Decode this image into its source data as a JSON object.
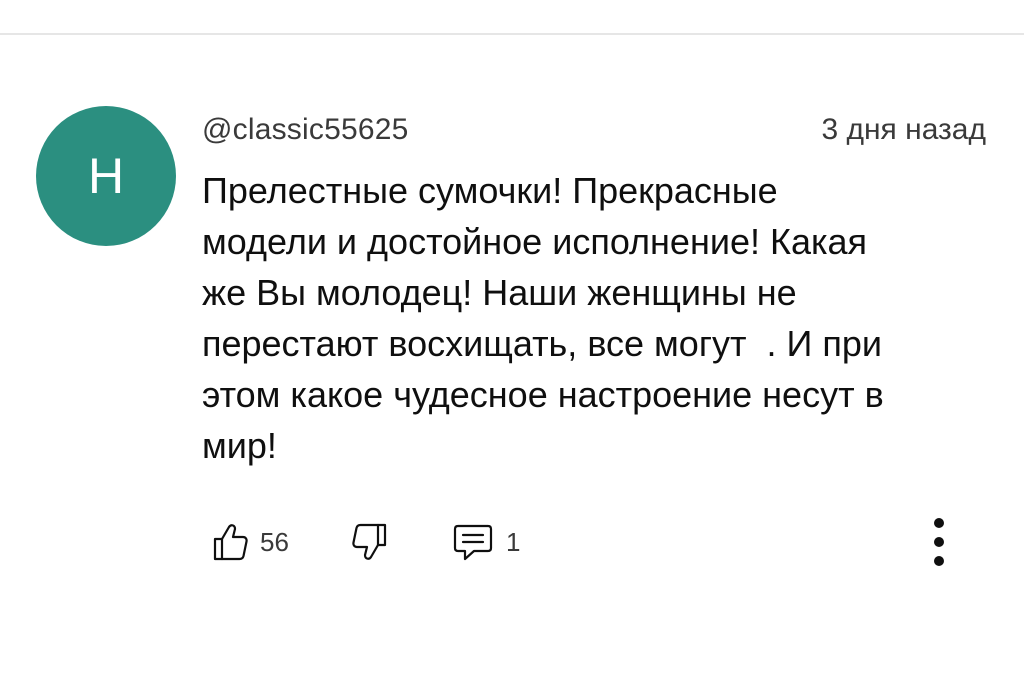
{
  "colors": {
    "avatar_bg": "#2b8f80",
    "text": "#0f0f0f",
    "meta_text": "#3a3a3a",
    "divider": "#e6e6e6"
  },
  "comment": {
    "avatar_letter": "H",
    "username": "@classic55625",
    "timestamp": "3 дня назад",
    "text_lines": [
      "Прелестные сумочки! Прекрасные",
      "модели и достойное исполнение! Какая",
      "же Вы молодец! Наши женщины не",
      "перестают восхищать, все могут  . И при",
      "этом какое чудесное настроение несут в",
      "мир!"
    ],
    "like_count": "56",
    "reply_count": "1",
    "icons": {
      "like": "thumb-up-icon",
      "dislike": "thumb-down-icon",
      "reply": "comment-icon",
      "more": "more-vertical-icon"
    }
  }
}
